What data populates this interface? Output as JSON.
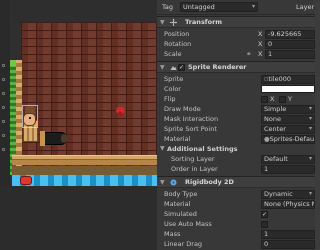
{
  "tag_bar": {
    "tag_label": "Tag",
    "tag_value": "Untagged",
    "layer_label": "Layer"
  },
  "transform": {
    "title": "Transform",
    "position_label": "Position",
    "position_x_label": "X",
    "position_x": "-9.625665",
    "rotation_label": "Rotation",
    "rotation_x_label": "X",
    "rotation_x": "0",
    "scale_label": "Scale",
    "scale_x_label": "X",
    "scale_x": "1"
  },
  "sprite_renderer": {
    "title": "Sprite Renderer",
    "sprite_label": "Sprite",
    "sprite_value": "tile000",
    "color_label": "Color",
    "flip_label": "Flip",
    "flip_x_label": "X",
    "flip_y_label": "Y",
    "draw_mode_label": "Draw Mode",
    "draw_mode_value": "Simple",
    "mask_interaction_label": "Mask Interaction",
    "mask_interaction_value": "None",
    "sprite_sort_point_label": "Sprite Sort Point",
    "sprite_sort_point_value": "Center",
    "material_label": "Material",
    "material_value": "Sprites-Default",
    "additional_settings_label": "Additional Settings",
    "sorting_layer_label": "Sorting Layer",
    "sorting_layer_value": "Default",
    "order_in_layer_label": "Order in Layer",
    "order_in_layer_value": "1"
  },
  "rigidbody2d": {
    "title": "Rigidbody 2D",
    "body_type_label": "Body Type",
    "body_type_value": "Dynamic",
    "material_label": "Material",
    "material_value": "None (Physics Mat",
    "simulated_label": "Simulated",
    "simulated_checked": true,
    "use_auto_mass_label": "Use Auto Mass",
    "use_auto_mass_checked": false,
    "mass_label": "Mass",
    "mass_value": "1",
    "linear_drag_label": "Linear Drag",
    "linear_drag_value": "0"
  },
  "colors": {
    "accent": "#cf2a2a",
    "panel": "#383838",
    "scene_bg": "#2f2f2f"
  }
}
